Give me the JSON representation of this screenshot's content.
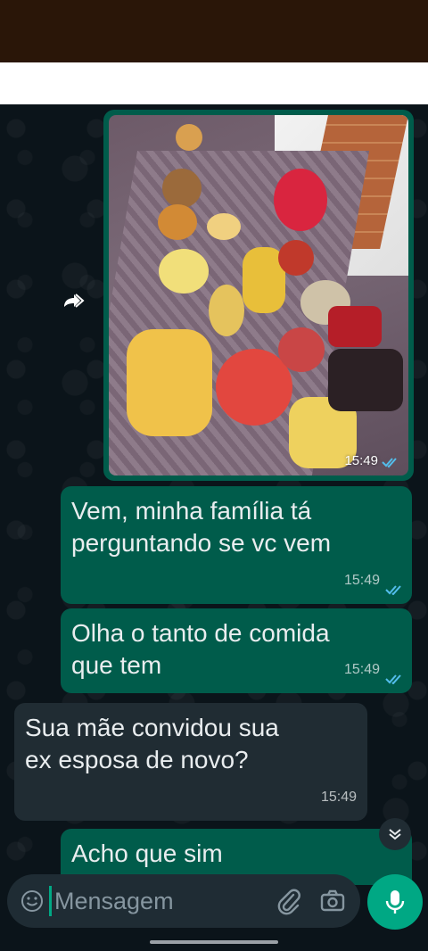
{
  "chat": {
    "image_message": {
      "time": "15:49",
      "status_icon": "double-check-icon"
    },
    "messages": [
      {
        "direction": "outgoing",
        "text_lines": [
          "Vem, minha família tá",
          "perguntando se vc vem"
        ],
        "time": "15:49"
      },
      {
        "direction": "outgoing",
        "text_lines": [
          "Olha o tanto de comida",
          "que tem"
        ],
        "time": "15:49"
      },
      {
        "direction": "incoming",
        "text_lines": [
          "Sua mãe convidou sua",
          "ex esposa de novo?"
        ],
        "time": "15:49"
      },
      {
        "direction": "outgoing",
        "text_lines": [
          "Acho que sim"
        ]
      }
    ]
  },
  "composer": {
    "placeholder": "Mensagem"
  },
  "icons": {
    "forward": "forward-icon",
    "scroll_down": "chevron-double-down-icon",
    "emoji": "emoji-icon",
    "attach": "paperclip-icon",
    "camera": "camera-icon",
    "mic": "mic-icon"
  },
  "colors": {
    "outgoing_bubble": "#005c4b",
    "incoming_bubble": "#202c33",
    "accent": "#00a884",
    "read_check": "#53bdeb"
  }
}
